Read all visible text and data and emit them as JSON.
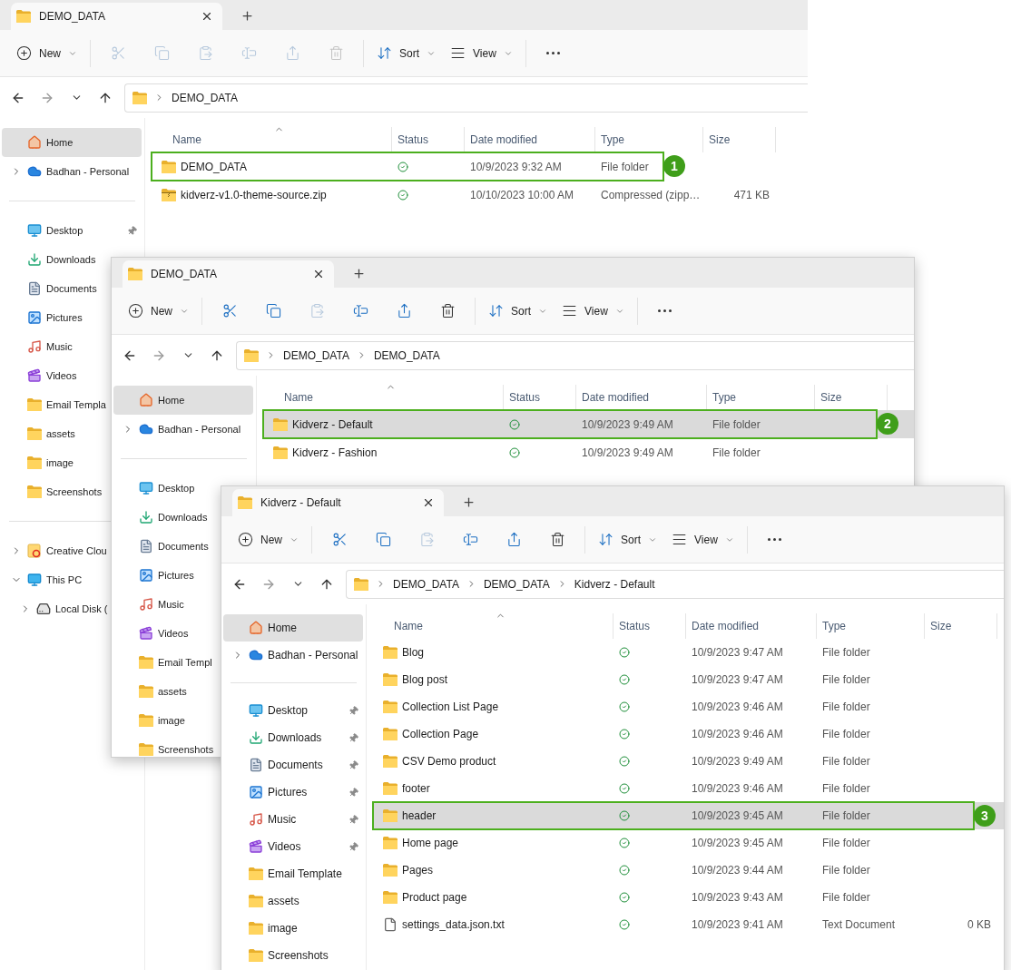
{
  "windows": [
    {
      "tab": {
        "title": "DEMO_DATA"
      },
      "toolbar": [
        {
          "kind": "new",
          "label": "New",
          "disabled": false
        },
        {
          "kind": "cut",
          "disabled": true
        },
        {
          "kind": "copy",
          "disabled": true
        },
        {
          "kind": "paste",
          "disabled": true
        },
        {
          "kind": "rename",
          "disabled": true
        },
        {
          "kind": "share",
          "disabled": true
        },
        {
          "kind": "delete",
          "disabled": true
        },
        {
          "kind": "sort",
          "label": "Sort",
          "disabled": false
        },
        {
          "kind": "view",
          "label": "View",
          "disabled": false
        },
        {
          "kind": "more",
          "disabled": false
        }
      ],
      "breadcrumb": [
        "DEMO_DATA"
      ],
      "sidebar": [
        [
          {
            "label": "Home",
            "kind": "home",
            "selected": true,
            "pinned": false
          },
          {
            "label": "Badhan - Personal",
            "kind": "cloud",
            "selected": false,
            "pinned": false,
            "expanded": false
          }
        ],
        [
          {
            "label": "Desktop",
            "kind": "desktop",
            "selected": false,
            "pinned": true
          },
          {
            "label": "Downloads",
            "kind": "downloads",
            "selected": false
          },
          {
            "label": "Documents",
            "kind": "documents",
            "selected": false
          },
          {
            "label": "Pictures",
            "kind": "pictures",
            "selected": false
          },
          {
            "label": "Music",
            "kind": "music",
            "selected": false
          },
          {
            "label": "Videos",
            "kind": "videos",
            "selected": false
          },
          {
            "label": "Email Templa",
            "kind": "folder",
            "selected": false
          },
          {
            "label": "assets",
            "kind": "folder",
            "selected": false
          },
          {
            "label": "image",
            "kind": "folder",
            "selected": false
          },
          {
            "label": "Screenshots",
            "kind": "folder",
            "selected": false
          }
        ],
        [
          {
            "label": "Creative Clou",
            "kind": "app-folder",
            "selected": false,
            "expanded": false
          },
          {
            "label": "This PC",
            "kind": "pc",
            "selected": false,
            "expanded": true,
            "children": [
              {
                "label": "Local Disk (",
                "kind": "drive",
                "selected": false,
                "expanded": false
              }
            ]
          }
        ]
      ],
      "columns": [
        "Name",
        "Status",
        "Date modified",
        "Type",
        "Size"
      ],
      "rows": [
        {
          "name": "DEMO_DATA",
          "kind": "folder",
          "synced": true,
          "date": "10/9/2023 9:32 AM",
          "type": "File folder",
          "selected": false,
          "callout": "1"
        },
        {
          "name": "kidverz-v1.0-theme-source.zip",
          "kind": "zip",
          "synced": true,
          "date": "10/10/2023 10:00 AM",
          "type": "Compressed (zipp…",
          "size": "471 KB",
          "selected": false
        }
      ]
    },
    {
      "tab": {
        "title": "DEMO_DATA"
      },
      "toolbar": [
        {
          "kind": "new",
          "label": "New",
          "disabled": false
        },
        {
          "kind": "cut",
          "disabled": false
        },
        {
          "kind": "copy",
          "disabled": false
        },
        {
          "kind": "paste",
          "disabled": true
        },
        {
          "kind": "rename",
          "disabled": false
        },
        {
          "kind": "share",
          "disabled": false
        },
        {
          "kind": "delete",
          "disabled": false
        },
        {
          "kind": "sort",
          "label": "Sort",
          "disabled": false
        },
        {
          "kind": "view",
          "label": "View",
          "disabled": false
        },
        {
          "kind": "more",
          "disabled": false
        }
      ],
      "breadcrumb": [
        "DEMO_DATA",
        "DEMO_DATA"
      ],
      "sidebar": [
        [
          {
            "label": "Home",
            "kind": "home",
            "selected": true,
            "pinned": false
          },
          {
            "label": "Badhan - Personal",
            "kind": "cloud",
            "selected": false,
            "pinned": false,
            "expanded": false
          }
        ],
        [
          {
            "label": "Desktop",
            "kind": "desktop",
            "selected": false
          },
          {
            "label": "Downloads",
            "kind": "downloads",
            "selected": false
          },
          {
            "label": "Documents",
            "kind": "documents",
            "selected": false
          },
          {
            "label": "Pictures",
            "kind": "pictures",
            "selected": false
          },
          {
            "label": "Music",
            "kind": "music",
            "selected": false
          },
          {
            "label": "Videos",
            "kind": "videos",
            "selected": false
          },
          {
            "label": "Email Templ",
            "kind": "folder",
            "selected": false
          },
          {
            "label": "assets",
            "kind": "folder",
            "selected": false
          },
          {
            "label": "image",
            "kind": "folder",
            "selected": false
          },
          {
            "label": "Screenshots",
            "kind": "folder",
            "selected": false
          }
        ]
      ],
      "columns": [
        "Name",
        "Status",
        "Date modified",
        "Type",
        "Size"
      ],
      "rows": [
        {
          "name": "Kidverz - Default",
          "kind": "folder",
          "synced": true,
          "date": "10/9/2023 9:49 AM",
          "type": "File folder",
          "selected": true,
          "callout": "2"
        },
        {
          "name": "Kidverz - Fashion",
          "kind": "folder",
          "synced": true,
          "date": "10/9/2023 9:49 AM",
          "type": "File folder",
          "selected": false
        }
      ]
    },
    {
      "tab": {
        "title": "Kidverz - Default"
      },
      "toolbar": [
        {
          "kind": "new",
          "label": "New",
          "disabled": false
        },
        {
          "kind": "cut",
          "disabled": false
        },
        {
          "kind": "copy",
          "disabled": false
        },
        {
          "kind": "paste",
          "disabled": true
        },
        {
          "kind": "rename",
          "disabled": false
        },
        {
          "kind": "share",
          "disabled": false
        },
        {
          "kind": "delete",
          "disabled": false
        },
        {
          "kind": "sort",
          "label": "Sort",
          "disabled": false
        },
        {
          "kind": "view",
          "label": "View",
          "disabled": false
        },
        {
          "kind": "more",
          "disabled": false
        }
      ],
      "breadcrumb": [
        "DEMO_DATA",
        "DEMO_DATA",
        "Kidverz - Default"
      ],
      "sidebar": [
        [
          {
            "label": "Home",
            "kind": "home",
            "selected": true,
            "pinned": false
          },
          {
            "label": "Badhan - Personal",
            "kind": "cloud",
            "selected": false,
            "expanded": false
          }
        ],
        [
          {
            "label": "Desktop",
            "kind": "desktop",
            "selected": false,
            "pinned": true
          },
          {
            "label": "Downloads",
            "kind": "downloads",
            "selected": false,
            "pinned": true
          },
          {
            "label": "Documents",
            "kind": "documents",
            "selected": false,
            "pinned": true
          },
          {
            "label": "Pictures",
            "kind": "pictures",
            "selected": false,
            "pinned": true
          },
          {
            "label": "Music",
            "kind": "music",
            "selected": false,
            "pinned": true
          },
          {
            "label": "Videos",
            "kind": "videos",
            "selected": false,
            "pinned": true
          },
          {
            "label": "Email Template",
            "kind": "folder",
            "selected": false,
            "pinned": false
          },
          {
            "label": "assets",
            "kind": "folder",
            "selected": false,
            "pinned": false
          },
          {
            "label": "image",
            "kind": "folder",
            "selected": false,
            "pinned": false
          },
          {
            "label": "Screenshots",
            "kind": "folder",
            "selected": false,
            "pinned": false
          }
        ]
      ],
      "columns": [
        "Name",
        "Status",
        "Date modified",
        "Type",
        "Size"
      ],
      "rows": [
        {
          "name": "Blog",
          "kind": "folder",
          "synced": true,
          "date": "10/9/2023 9:47 AM",
          "type": "File folder",
          "selected": false
        },
        {
          "name": "Blog post",
          "kind": "folder",
          "synced": true,
          "date": "10/9/2023 9:47 AM",
          "type": "File folder",
          "selected": false
        },
        {
          "name": "Collection List Page",
          "kind": "folder",
          "synced": true,
          "date": "10/9/2023 9:46 AM",
          "type": "File folder",
          "selected": false
        },
        {
          "name": "Collection Page",
          "kind": "folder",
          "synced": true,
          "date": "10/9/2023 9:46 AM",
          "type": "File folder",
          "selected": false
        },
        {
          "name": "CSV Demo product",
          "kind": "folder",
          "synced": true,
          "date": "10/9/2023 9:49 AM",
          "type": "File folder",
          "selected": false
        },
        {
          "name": "footer",
          "kind": "folder",
          "synced": true,
          "date": "10/9/2023 9:46 AM",
          "type": "File folder",
          "selected": false
        },
        {
          "name": "header",
          "kind": "folder",
          "synced": true,
          "date": "10/9/2023 9:45 AM",
          "type": "File folder",
          "selected": true,
          "callout": "3"
        },
        {
          "name": "Home page",
          "kind": "folder",
          "synced": true,
          "date": "10/9/2023 9:45 AM",
          "type": "File folder",
          "selected": false
        },
        {
          "name": "Pages",
          "kind": "folder",
          "synced": true,
          "date": "10/9/2023 9:44 AM",
          "type": "File folder",
          "selected": false
        },
        {
          "name": "Product page",
          "kind": "folder",
          "synced": true,
          "date": "10/9/2023 9:43 AM",
          "type": "File folder",
          "selected": false
        },
        {
          "name": "settings_data.json.txt",
          "kind": "text",
          "synced": true,
          "date": "10/9/2023 9:41 AM",
          "type": "Text Document",
          "size": "0 KB",
          "selected": false
        }
      ]
    }
  ]
}
